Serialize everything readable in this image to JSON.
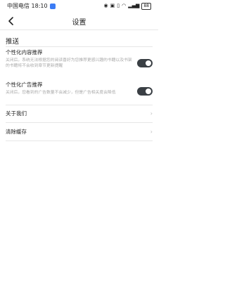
{
  "status_bar": {
    "carrier_time": "中国电信 18:10",
    "battery": "88"
  },
  "header": {
    "title": "设置",
    "back_icon": "back-arrow-icon"
  },
  "section": {
    "title": "推送"
  },
  "settings": [
    {
      "title": "个性化内容推荐",
      "description": "关闭后，系统无法根据您的阅读喜好为您推荐更感兴趣的书籍以及书架的书籍将不会收到章节更新提醒",
      "enabled": true
    },
    {
      "title": "个性化广告推荐",
      "description": "关闭后，您看到的广告数量不会减少，但是广告相关度会降低",
      "enabled": true
    }
  ],
  "links": [
    {
      "label": "关于我们"
    },
    {
      "label": "清除缓存"
    }
  ],
  "colors": {
    "toggle_on": "#3a3f44",
    "divider": "#e6e6e6",
    "secondary_text": "#aaaaaa"
  }
}
